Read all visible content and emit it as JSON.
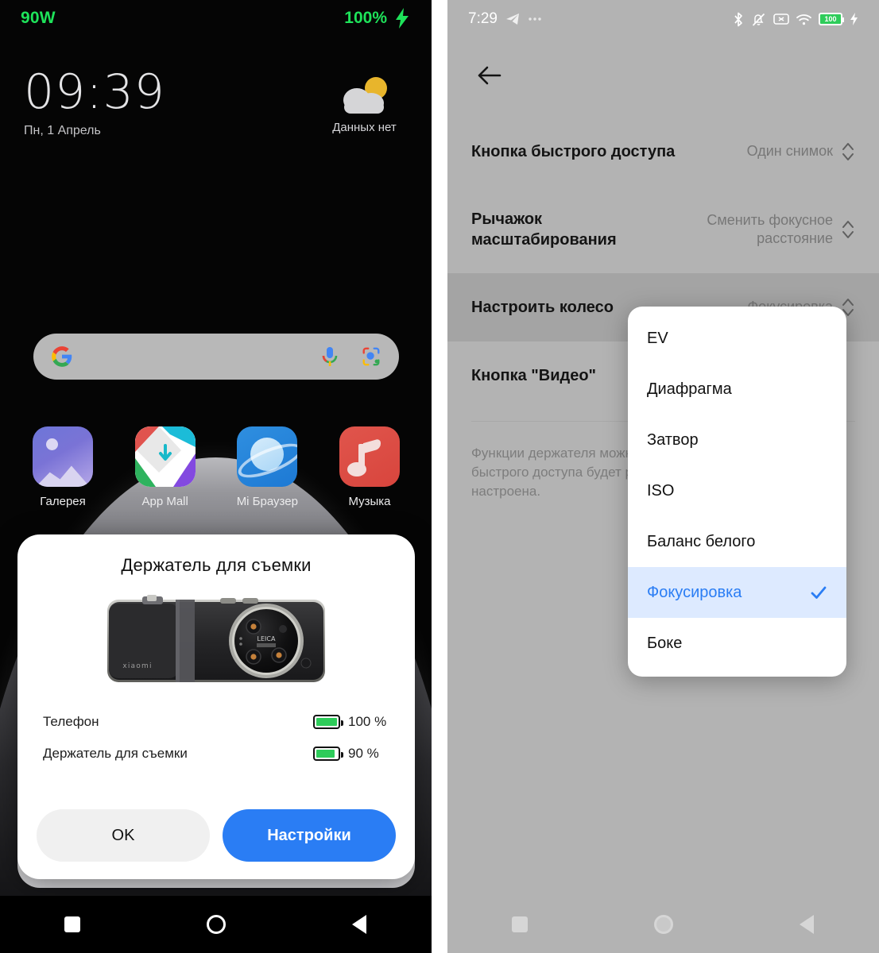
{
  "left": {
    "status": {
      "watt": "90W",
      "battery_percent": "100%",
      "charging_icon": "lightning-bolt-icon"
    },
    "clock": {
      "time": "09:39",
      "date": "Пн, 1 Апрель"
    },
    "weather": {
      "condition": "Данных нет",
      "icon": "cloud-sun-icon"
    },
    "search": {
      "google_icon": "google-g-icon",
      "mic_icon": "microphone-icon",
      "lens_icon": "google-lens-icon"
    },
    "apps": [
      {
        "label": "Галерея",
        "icon": "gallery-icon"
      },
      {
        "label": "App Mall",
        "icon": "app-mall-icon"
      },
      {
        "label": "Mi Браузер",
        "icon": "mi-browser-icon"
      },
      {
        "label": "Музыка",
        "icon": "music-icon"
      }
    ],
    "dialog": {
      "title": "Держатель для съемки",
      "product_image": "xiaomi-camera-grip-photo",
      "rows": [
        {
          "label": "Телефон",
          "percent": "100 %",
          "level": 100
        },
        {
          "label": "Держатель для съемки",
          "percent": "90 %",
          "level": 90
        }
      ],
      "ok_label": "OK",
      "settings_label": "Настройки",
      "primary_color": "#2a7df4"
    },
    "navbar": {
      "recents": "recents-square-icon",
      "home": "home-circle-icon",
      "back": "back-triangle-icon"
    }
  },
  "right": {
    "status": {
      "time": "7:29",
      "send_icon": "telegram-send-icon",
      "more_icon": "more-dots-icon",
      "icons": [
        "bluetooth-icon",
        "mute-bell-icon",
        "no-sim-icon",
        "wifi-icon"
      ],
      "battery_label": "100",
      "charging_icon": "lightning-bolt-icon"
    },
    "back_icon": "arrow-left-icon",
    "settings": [
      {
        "label": "Кнопка быстрого доступа",
        "value": "Один снимок",
        "stepper": "stepper-updown-icon",
        "selected": false,
        "tall": false
      },
      {
        "label": "Рычажок масштабирования",
        "value": "Сменить фокусное расстояние",
        "stepper": "stepper-updown-icon",
        "selected": false,
        "tall": true
      },
      {
        "label": "Настроить колесо",
        "value": "Фокусировка",
        "stepper": "stepper-updown-icon",
        "selected": true,
        "tall": false
      },
      {
        "label": "Кнопка \"Видео\"",
        "value": "",
        "stepper": "stepper-updown-icon",
        "selected": false,
        "tall": false
      }
    ],
    "note": "Функции держателя можно настраивать отдельно. Кнопка быстрого доступа будет работать в режиме, в котором она настроена.",
    "dropdown": {
      "items": [
        {
          "label": "EV",
          "active": false
        },
        {
          "label": "Диафрагма",
          "active": false
        },
        {
          "label": "Затвор",
          "active": false
        },
        {
          "label": "ISO",
          "active": false
        },
        {
          "label": "Баланс белого",
          "active": false
        },
        {
          "label": "Фокусировка",
          "active": true
        },
        {
          "label": "Боке",
          "active": false
        }
      ],
      "check_icon": "check-mark-icon",
      "active_color": "#2a7df4",
      "active_bg": "#ddeaff"
    },
    "navbar": {
      "recents": "recents-square-icon",
      "home": "home-circle-icon",
      "back": "back-triangle-icon"
    }
  }
}
